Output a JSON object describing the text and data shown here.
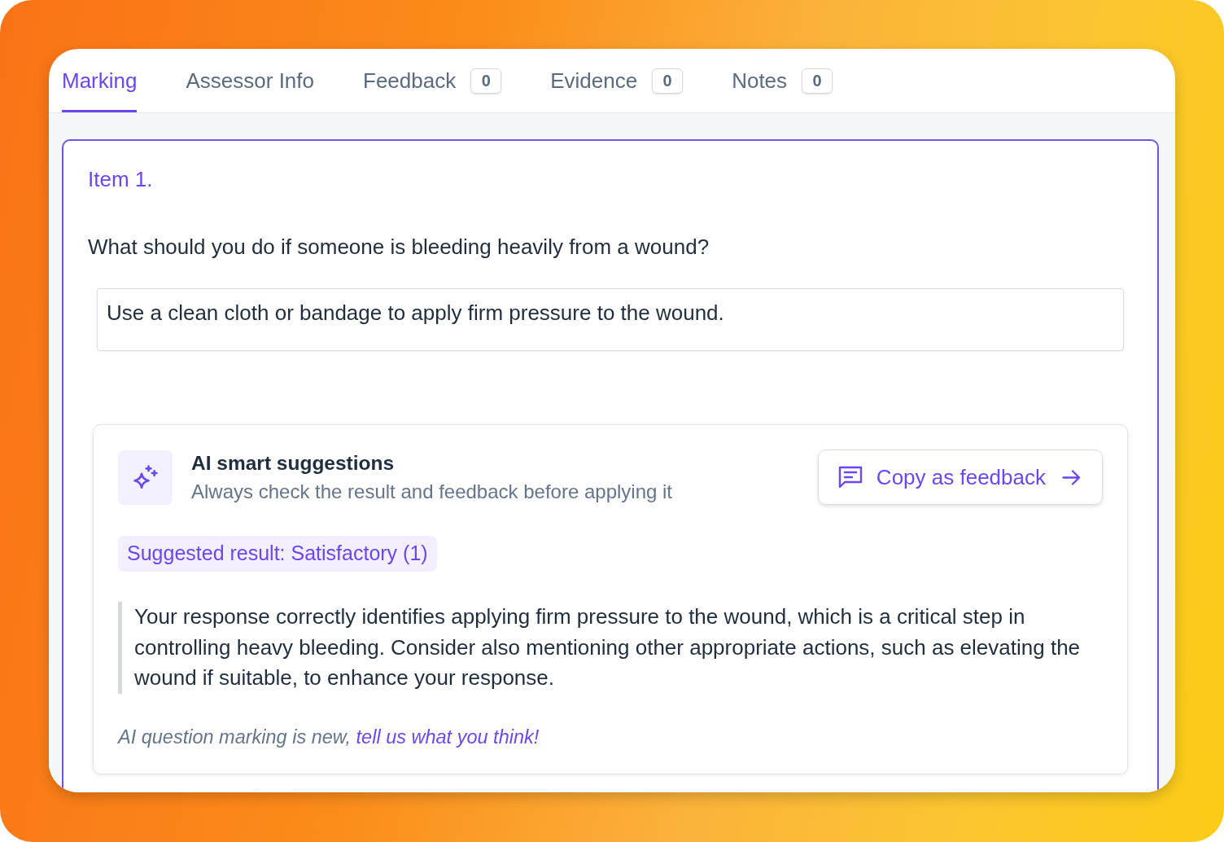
{
  "tabs": [
    {
      "label": "Marking",
      "selected": true
    },
    {
      "label": "Assessor Info",
      "selected": false
    },
    {
      "label": "Feedback",
      "count": "0",
      "selected": false
    },
    {
      "label": "Evidence",
      "count": "0",
      "selected": false
    },
    {
      "label": "Notes",
      "count": "0",
      "selected": false
    }
  ],
  "item": {
    "title": "Item 1.",
    "question": "What should you do if someone is bleeding heavily from a wound?",
    "answer": "Use a clean cloth or bandage to apply firm pressure to the wound."
  },
  "ai_suggestions": {
    "title": "AI smart suggestions",
    "subtitle": "Always check the result and feedback before applying it",
    "copy_button": "Copy as feedback",
    "suggested_result": "Suggested result: Satisfactory (1)",
    "feedback": "Your response correctly identifies applying firm pressure to the wound, which is a critical step in controlling heavy bleeding. Consider also mentioning other appropriate actions, such as elevating the wound if suitable, to enhance your response.",
    "footer_note": "AI question marking is new,",
    "footer_link": "tell us what you think!"
  }
}
